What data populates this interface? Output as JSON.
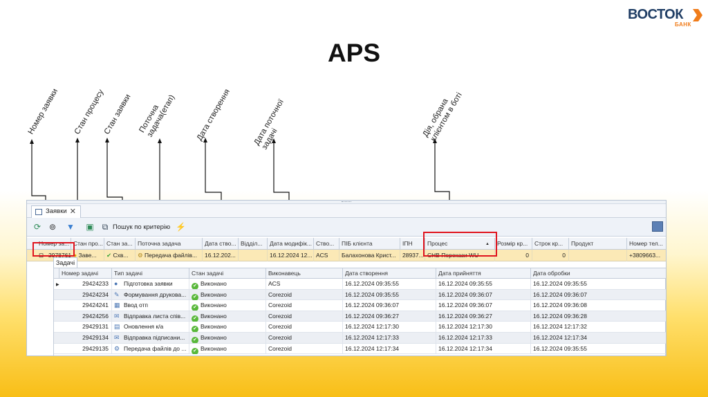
{
  "logo": {
    "word": "ВОСТОК",
    "sub": "БАНК",
    "brand_color": "#1f3d64",
    "accent_color": "#f07c1a"
  },
  "title": "APS",
  "annotations": {
    "num": "Номер заявки",
    "proc_state": "Стан процесу",
    "app_state": "Стан заявки",
    "current_task": "Поточна\nзадача(етап)",
    "created": "Дата створення",
    "current_date": "Дата поточної\nзадачі",
    "action": "Дія, обрана\nклієнтом в боті"
  },
  "window": {
    "tab_label": "Заявки",
    "search_label": "Пошук по критерію",
    "columns": [
      "Номер за...",
      "Стан про...",
      "Стан за...",
      "Поточна задача",
      "Дата ство...",
      "Відділ...",
      "Дата модифік...",
      "Ство...",
      "ПІБ клієнта",
      "ІПН",
      "Процес",
      "Розмір кр...",
      "Строк кр...",
      "Продукт",
      "Номер тел..."
    ],
    "row": {
      "num": "2978761",
      "proc_state": "Заве...",
      "app_state": "Схв...",
      "current_task": "Передача файлів...",
      "created": "16.12.202...",
      "dept": "",
      "modified": "16.12.2024 12...",
      "creator": "ACS",
      "client": "Балахонова Крист...",
      "ipn": "28937...",
      "process": "СНВ Перекази WU",
      "credit_size": "0",
      "credit_term": "0",
      "product": "",
      "phone": "+3809663..."
    }
  },
  "tasks": {
    "tab_label": "Задачі",
    "columns": [
      "Номер задачі",
      "Тип задачі",
      "Стан задачі",
      "Виконавець",
      "Дата створення",
      "Дата прийняття",
      "Дата обробки"
    ],
    "rows": [
      {
        "id": "29424233",
        "type": "Підготовка заявки",
        "icon": "globe-icon",
        "status": "Виконано",
        "executor": "ACS",
        "created": "16.12.2024 09:35:55",
        "accepted": "16.12.2024 09:35:55",
        "processed": "16.12.2024 09:35:55"
      },
      {
        "id": "29424234",
        "type": "Формування друкова...",
        "icon": "document-edit-icon",
        "status": "Виконано",
        "executor": "Corezoid",
        "created": "16.12.2024 09:35:55",
        "accepted": "16.12.2024 09:36:07",
        "processed": "16.12.2024 09:36:07"
      },
      {
        "id": "29424241",
        "type": "Ввод отп",
        "icon": "keypad-icon",
        "status": "Виконано",
        "executor": "Corezoid",
        "created": "16.12.2024 09:36:07",
        "accepted": "16.12.2024 09:36:07",
        "processed": "16.12.2024 09:36:08"
      },
      {
        "id": "29424256",
        "type": "Відправка листа спів...",
        "icon": "mail-icon",
        "status": "Виконано",
        "executor": "Corezoid",
        "created": "16.12.2024 09:36:27",
        "accepted": "16.12.2024 09:36:27",
        "processed": "16.12.2024 09:36:28"
      },
      {
        "id": "29429131",
        "type": "Оновлення к/а",
        "icon": "contact-card-icon",
        "status": "Виконано",
        "executor": "Corezoid",
        "created": "16.12.2024 12:17:30",
        "accepted": "16.12.2024 12:17:30",
        "processed": "16.12.2024 12:17:32"
      },
      {
        "id": "29429134",
        "type": "Відправка підписани...",
        "icon": "mail-icon",
        "status": "Виконано",
        "executor": "Corezoid",
        "created": "16.12.2024 12:17:33",
        "accepted": "16.12.2024 12:17:33",
        "processed": "16.12.2024 12:17:34"
      },
      {
        "id": "29429135",
        "type": "Передача файлів до ...",
        "icon": "file-transfer-icon",
        "status": "Виконано",
        "executor": "Corezoid",
        "created": "16.12.2024 12:17:34",
        "accepted": "16.12.2024 12:17:34",
        "processed": "16.12.2024 09:35:55"
      }
    ]
  },
  "colors": {
    "selected_row": "#fbe9b6",
    "highlight": "#e0131d",
    "ok_green": "#59b83a"
  }
}
